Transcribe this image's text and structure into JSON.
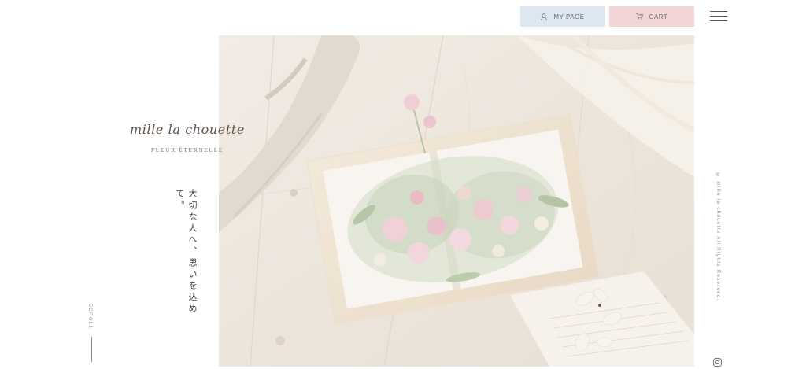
{
  "header": {
    "mypage_label": "MY PAGE",
    "cart_label": "CART",
    "menu_icon": "hamburger-menu-icon"
  },
  "brand": {
    "logo": "mille la chouette",
    "subtitle": "FLEUR ÉTERNELLE"
  },
  "tagline": "大切な人へ、思いを込めて。",
  "scroll": {
    "label": "SCROLL"
  },
  "footer": {
    "copyright": "© mille la chouette All Rights Reserved.",
    "instagram_icon": "instagram-icon"
  },
  "colors": {
    "mypage_bg": "#dde7f1",
    "cart_bg": "#f2d5d6",
    "text_dark": "#4a4038"
  }
}
